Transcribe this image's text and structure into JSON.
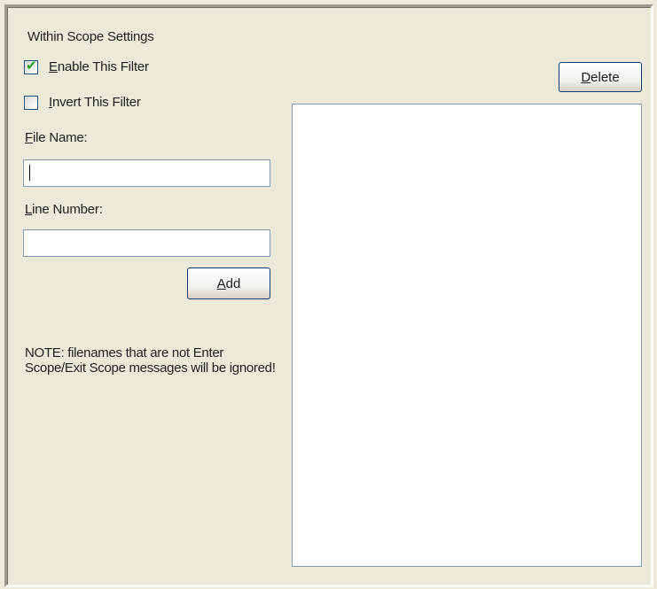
{
  "group": {
    "title": "Within Scope Settings"
  },
  "enable_filter": {
    "accel": "E",
    "rest": "nable This Filter",
    "checked": true
  },
  "invert_filter": {
    "accel": "I",
    "rest": "nvert This Filter",
    "checked": false
  },
  "file_name": {
    "accel": "F",
    "rest": "ile Name:",
    "value": ""
  },
  "line_number": {
    "accel": "L",
    "rest": "ine Number:",
    "value": ""
  },
  "add_button": {
    "accel": "A",
    "rest": "dd"
  },
  "delete_button": {
    "accel": "D",
    "rest": "elete"
  },
  "note": "NOTE: filenames that are not Enter Scope/Exit Scope messages will be ignored!",
  "colors": {
    "background": "#ece9d8",
    "input_border": "#7f9db9",
    "button_border": "#003c74",
    "check_mark": "#21a121"
  }
}
